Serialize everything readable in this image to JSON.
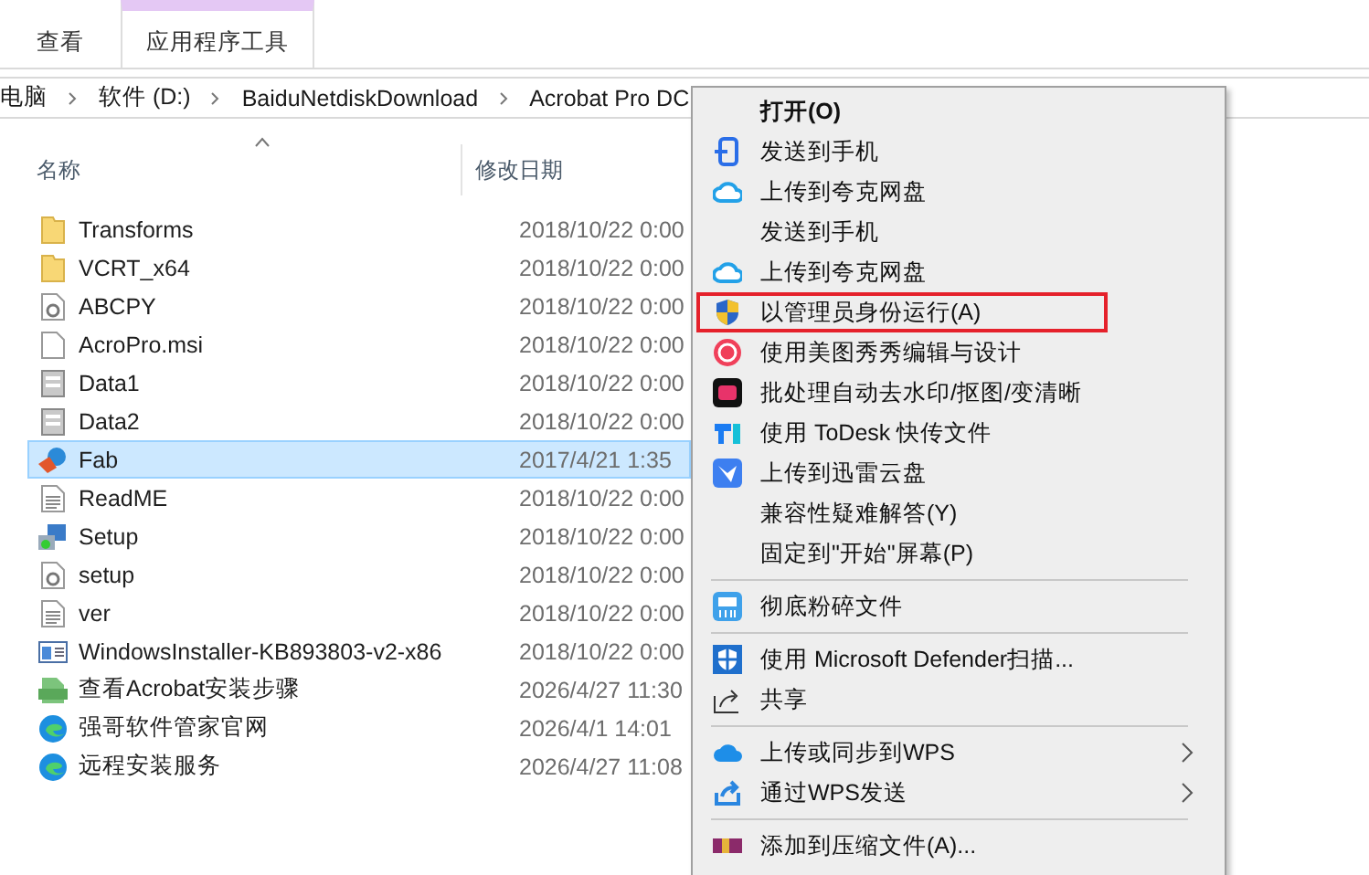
{
  "ribbon": {
    "tabs": [
      {
        "label": "查看",
        "selected": false
      },
      {
        "label": "应用程序工具",
        "selected": true
      }
    ]
  },
  "address_bar": {
    "crumbs": [
      "电脑",
      "软件 (D:)",
      "BaiduNetdiskDownload",
      "Acrobat Pro DC"
    ]
  },
  "file_list": {
    "columns": [
      "名称",
      "修改日期"
    ],
    "rows": [
      {
        "name": "Transforms",
        "date": "2018/10/22 0:00",
        "selected": false
      },
      {
        "name": "VCRT_x64",
        "date": "2018/10/22 0:00",
        "selected": false
      },
      {
        "name": "ABCPY",
        "date": "2018/10/22 0:00",
        "selected": false
      },
      {
        "name": "AcroPro.msi",
        "date": "2018/10/22 0:00",
        "selected": false
      },
      {
        "name": "Data1",
        "date": "2018/10/22 0:00",
        "selected": false
      },
      {
        "name": "Data2",
        "date": "2018/10/22 0:00",
        "selected": false
      },
      {
        "name": "Fab",
        "date": "2017/4/21 1:35",
        "selected": true
      },
      {
        "name": "ReadME",
        "date": "2018/10/22 0:00",
        "selected": false
      },
      {
        "name": "Setup",
        "date": "2018/10/22 0:00",
        "selected": false
      },
      {
        "name": "setup",
        "date": "2018/10/22 0:00",
        "selected": false
      },
      {
        "name": "ver",
        "date": "2018/10/22 0:00",
        "selected": false
      },
      {
        "name": "WindowsInstaller-KB893803-v2-x86",
        "date": "2018/10/22 0:00",
        "selected": false
      },
      {
        "name": "查看Acrobat安装步骤",
        "date": "2026/4/27 11:30",
        "selected": false
      },
      {
        "name": "强哥软件管家官网",
        "date": "2026/4/1 14:01",
        "selected": false
      },
      {
        "name": "远程安装服务",
        "date": "2026/4/27 11:08",
        "selected": false
      }
    ]
  },
  "context_menu": {
    "items": [
      {
        "kind": "item",
        "label": "打开(O)",
        "bold": true,
        "highlighted": false,
        "submenu": false
      },
      {
        "kind": "item",
        "label": "发送到手机",
        "bold": false,
        "highlighted": false,
        "submenu": false
      },
      {
        "kind": "item",
        "label": "上传到夸克网盘",
        "bold": false,
        "highlighted": false,
        "submenu": false
      },
      {
        "kind": "item",
        "label": "发送到手机",
        "bold": false,
        "highlighted": false,
        "submenu": false
      },
      {
        "kind": "item",
        "label": "上传到夸克网盘",
        "bold": false,
        "highlighted": false,
        "submenu": false
      },
      {
        "kind": "item",
        "label": "以管理员身份运行(A)",
        "bold": false,
        "highlighted": true,
        "submenu": false
      },
      {
        "kind": "item",
        "label": "使用美图秀秀编辑与设计",
        "bold": false,
        "highlighted": false,
        "submenu": false
      },
      {
        "kind": "item",
        "label": "批处理自动去水印/抠图/变清晰",
        "bold": false,
        "highlighted": false,
        "submenu": false
      },
      {
        "kind": "item",
        "label": "使用 ToDesk 快传文件",
        "bold": false,
        "highlighted": false,
        "submenu": false
      },
      {
        "kind": "item",
        "label": "上传到迅雷云盘",
        "bold": false,
        "highlighted": false,
        "submenu": false
      },
      {
        "kind": "item",
        "label": "兼容性疑难解答(Y)",
        "bold": false,
        "highlighted": false,
        "submenu": false
      },
      {
        "kind": "item",
        "label": "固定到\"开始\"屏幕(P)",
        "bold": false,
        "highlighted": false,
        "submenu": false
      },
      {
        "kind": "separator"
      },
      {
        "kind": "item",
        "label": "彻底粉碎文件",
        "bold": false,
        "highlighted": false,
        "submenu": false
      },
      {
        "kind": "separator"
      },
      {
        "kind": "item",
        "label": "使用 Microsoft Defender扫描...",
        "bold": false,
        "highlighted": false,
        "submenu": false
      },
      {
        "kind": "item",
        "label": "共享",
        "bold": false,
        "highlighted": false,
        "submenu": false
      },
      {
        "kind": "separator"
      },
      {
        "kind": "item",
        "label": "上传或同步到WPS",
        "bold": false,
        "highlighted": false,
        "submenu": true
      },
      {
        "kind": "item",
        "label": "通过WPS发送",
        "bold": false,
        "highlighted": false,
        "submenu": true
      },
      {
        "kind": "separator"
      },
      {
        "kind": "item",
        "label": "添加到压缩文件(A)...",
        "bold": false,
        "highlighted": false,
        "submenu": false
      }
    ]
  }
}
